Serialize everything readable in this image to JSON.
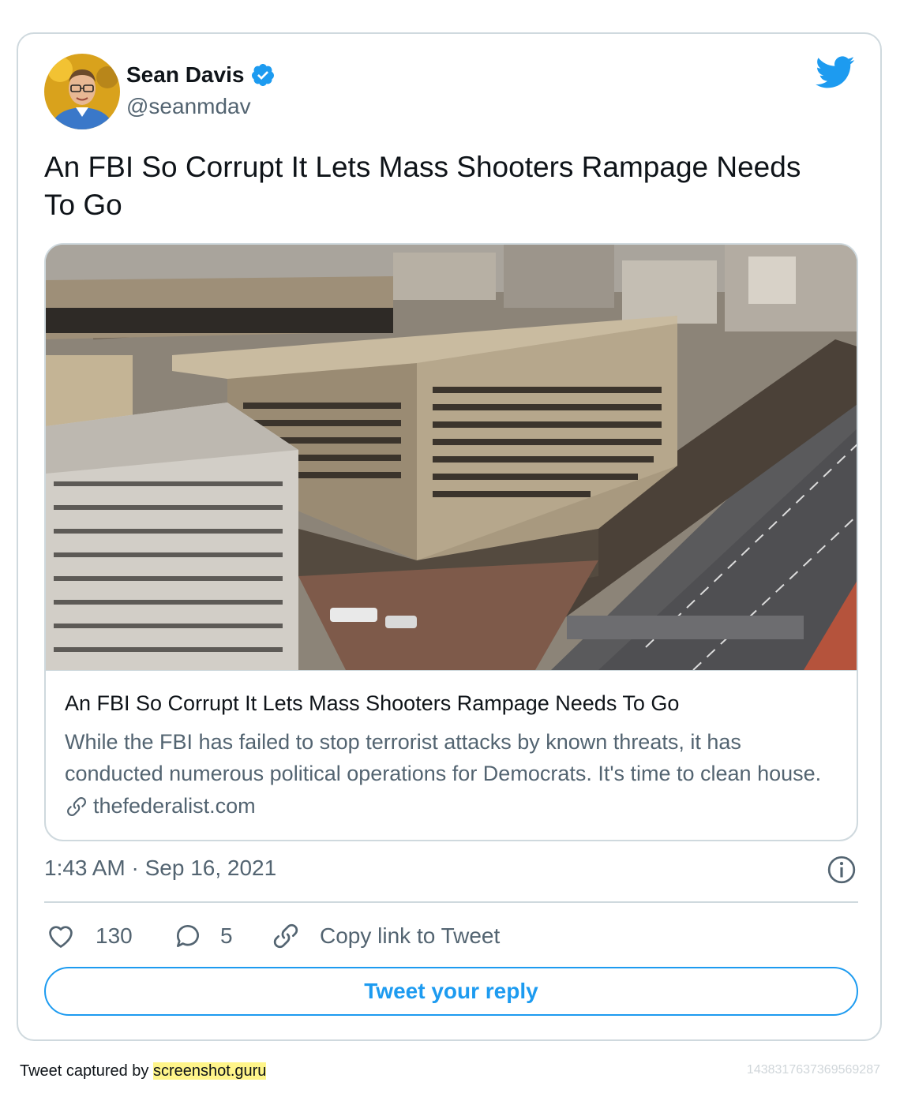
{
  "author": {
    "name": "Sean Davis",
    "handle": "@seanmdav",
    "verified": true,
    "avatar_icon": "avatar-photo"
  },
  "brand_icon": "twitter-bird-icon",
  "tweet": {
    "text": "An FBI So Corrupt It Lets Mass Shooters Rampage Needs To Go",
    "timestamp": "1:43 AM · Sep 16, 2021"
  },
  "link_card": {
    "image_icon": "fbi-building-aerial-photo",
    "title": "An FBI So Corrupt It Lets Mass Shooters Rampage Needs To Go",
    "description": "While the FBI has failed to stop terrorist attacks by known threats, it has conducted numerous political operations for Democrats. It's time to clean house.",
    "domain": "thefederalist.com"
  },
  "actions": {
    "likes": "130",
    "replies": "5",
    "copy_link_label": "Copy link to Tweet"
  },
  "reply_button_label": "Tweet your reply",
  "footer": {
    "prefix": "Tweet captured by ",
    "service": "screenshot.guru",
    "tweet_id": "1438317637369569287"
  },
  "colors": {
    "accent": "#1d9bf0",
    "text_primary": "#0f1419",
    "text_secondary": "#536471",
    "border": "#cfd9de",
    "highlight": "#fff58a"
  }
}
